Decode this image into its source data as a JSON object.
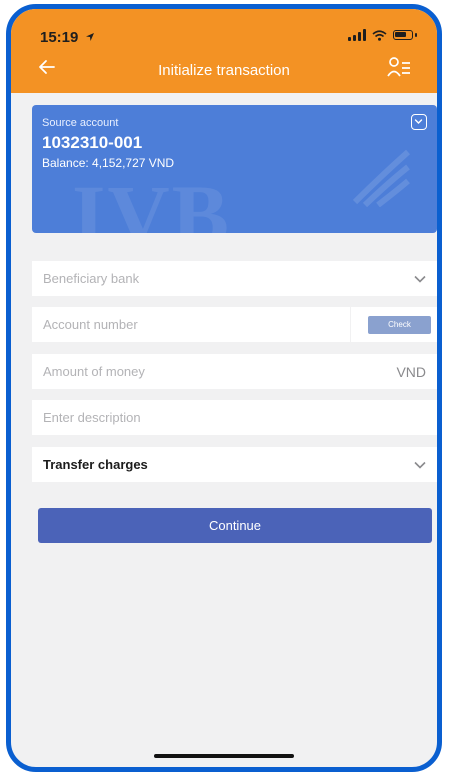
{
  "status_bar": {
    "time": "15:19",
    "icons": [
      "location-arrow-icon",
      "signal-icon",
      "wifi-icon",
      "battery-icon"
    ]
  },
  "nav": {
    "title": "Initialize transaction",
    "back_icon": "back-arrow-icon",
    "contacts_icon": "contacts-list-icon"
  },
  "source_account": {
    "label": "Source account",
    "number": "1032310-001",
    "balance": "Balance: 4,152,727 VND",
    "watermark": "IVB"
  },
  "form": {
    "beneficiary_bank": {
      "placeholder": "Beneficiary bank"
    },
    "account_number": {
      "placeholder": "Account number",
      "check_label": "Check"
    },
    "amount": {
      "placeholder": "Amount of money",
      "currency": "VND"
    },
    "description": {
      "placeholder": "Enter description"
    },
    "transfer_charges": {
      "label": "Transfer charges"
    }
  },
  "actions": {
    "continue_label": "Continue"
  },
  "colors": {
    "header": "#f39224",
    "card": "#4d7ed8",
    "primary_button": "#4b63b8",
    "check_button": "#8aa1cf",
    "frame": "#0a5fd0"
  }
}
